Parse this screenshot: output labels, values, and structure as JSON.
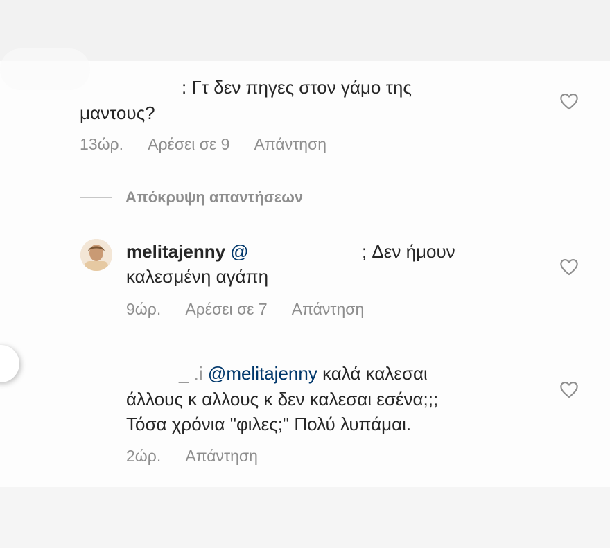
{
  "comments": [
    {
      "lead": ": Γτ δεν πηγες στον γάμο της",
      "line2": "μαντους?",
      "time": "13ώρ.",
      "likes": "Αρέσει σε 9",
      "reply": "Απάντηση"
    },
    {
      "username": "melitajenny",
      "mention_prefix": "@",
      "text_end": "; Δεν ήμουν",
      "line2": "καλεσμένη αγάπη",
      "time": "9ώρ.",
      "likes": "Αρέσει σε 7",
      "reply": "Απάντηση"
    },
    {
      "username_fragment": "_   .i",
      "mention": "@melitajenny",
      "text_end": "καλά καλεσαι",
      "line2": "άλλους κ αλλους κ δεν καλεσαι εσένα;;;",
      "line3": "Τόσα χρόνια \"φιλες;\" Πολύ λυπάμαι.",
      "time": "2ώρ.",
      "reply": "Απάντηση"
    }
  ],
  "hide_replies": "Απόκρυψη απαντήσεων",
  "icons": {
    "like": "heart-outline-icon",
    "avatar": "profile-avatar"
  },
  "colors": {
    "text": "#262626",
    "meta": "#8e8e8e",
    "mention": "#00376b"
  }
}
